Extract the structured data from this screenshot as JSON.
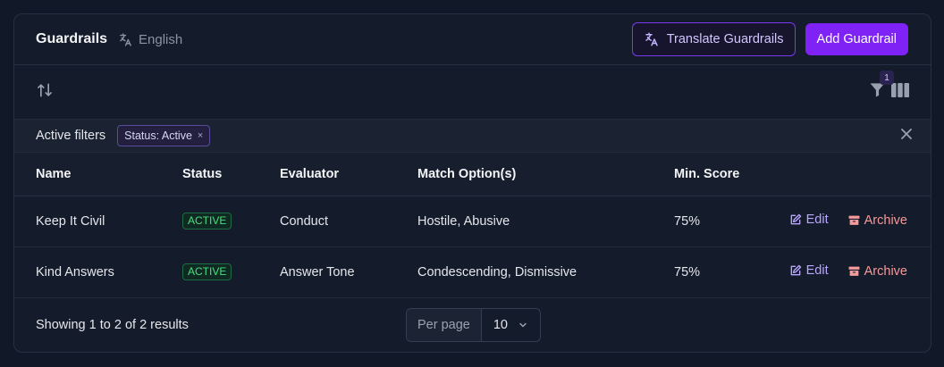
{
  "header": {
    "title": "Guardrails",
    "language": "English",
    "translate_button": "Translate Guardrails",
    "add_button": "Add Guardrail"
  },
  "toolbar": {
    "filter_count": "1"
  },
  "filters": {
    "label": "Active filters",
    "chips": [
      {
        "text": "Status: Active",
        "remove": "×"
      }
    ]
  },
  "table": {
    "columns": [
      "Name",
      "Status",
      "Evaluator",
      "Match Option(s)",
      "Min. Score"
    ],
    "rows": [
      {
        "name": "Keep It Civil",
        "status": "ACTIVE",
        "evaluator": "Conduct",
        "match": "Hostile, Abusive",
        "score": "75%"
      },
      {
        "name": "Kind Answers",
        "status": "ACTIVE",
        "evaluator": "Answer Tone",
        "match": "Condescending, Dismissive",
        "score": "75%"
      }
    ],
    "edit_label": "Edit",
    "archive_label": "Archive"
  },
  "footer": {
    "results_text": "Showing 1 to 2 of 2 results",
    "per_page_label": "Per page",
    "per_page_value": "10"
  },
  "colors": {
    "accent": "#7e22f5",
    "active_badge": "#4ade80",
    "archive": "#f59a9a"
  },
  "icons": [
    "translate-icon",
    "sort-icon",
    "filter-icon",
    "columns-icon",
    "close-icon",
    "edit-icon",
    "archive-icon",
    "chevron-down-icon"
  ]
}
